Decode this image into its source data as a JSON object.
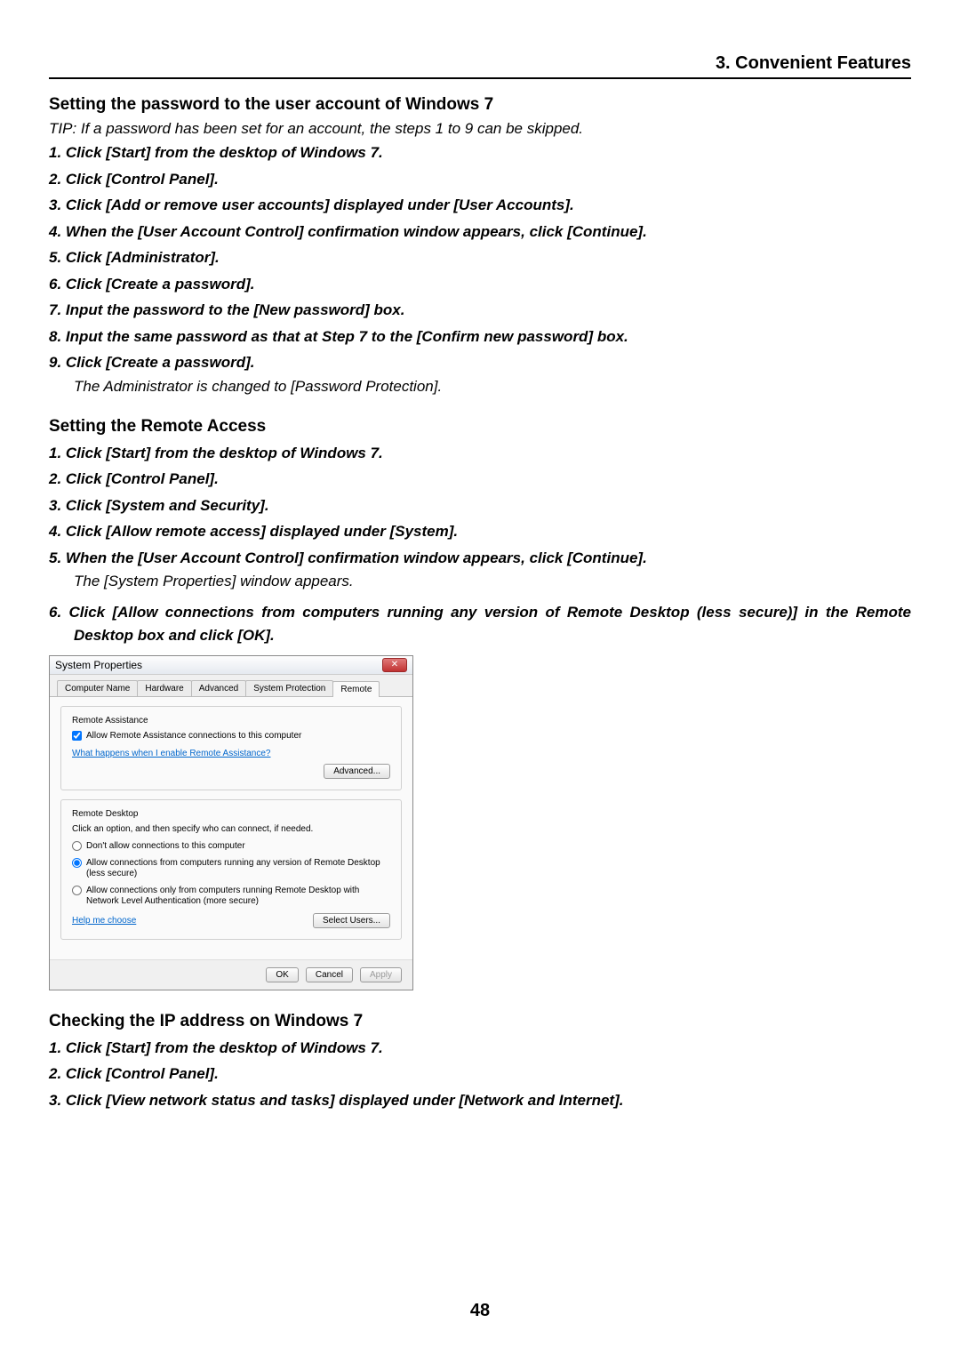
{
  "chapter_header": "3. Convenient Features",
  "section1": {
    "title": "Setting the password to the user account of Windows 7",
    "tip": "TIP: If a password has been set for an account, the steps 1 to 9 can be skipped.",
    "steps": [
      "1.  Click [Start] from the desktop of Windows 7.",
      "2.  Click [Control Panel].",
      "3.  Click [Add or remove user accounts] displayed under [User Accounts].",
      "4.  When the [User Account Control] confirmation window appears, click [Continue].",
      "5.  Click [Administrator].",
      "6.  Click [Create a password].",
      "7.  Input the password to the [New password] box.",
      "8.  Input the same password as that at Step 7 to the [Confirm new password] box.",
      "9.  Click [Create a password]."
    ],
    "result": "The Administrator is changed to [Password Protection]."
  },
  "section2": {
    "title": "Setting the Remote Access",
    "steps_pre": [
      "1.  Click [Start] from the desktop of Windows 7.",
      "2.  Click [Control Panel].",
      "3.  Click [System and Security].",
      "4.  Click [Allow remote access] displayed under [System].",
      "5.  When the [User Account Control] confirmation window appears, click [Continue]."
    ],
    "result5": "The [System Properties] window appears.",
    "step6": "6.  Click [Allow connections from computers running any version of Remote Desktop (less secure)] in the Remote Desktop box and click [OK]."
  },
  "dialog": {
    "title": "System Properties",
    "tabs": [
      "Computer Name",
      "Hardware",
      "Advanced",
      "System Protection",
      "Remote"
    ],
    "ra": {
      "group_title": "Remote Assistance",
      "checkbox_label": "Allow Remote Assistance connections to this computer",
      "link": "What happens when I enable Remote Assistance?",
      "advanced_btn": "Advanced..."
    },
    "rd": {
      "group_title": "Remote Desktop",
      "desc": "Click an option, and then specify who can connect, if needed.",
      "opt1": "Don't allow connections to this computer",
      "opt2": "Allow connections from computers running any version of Remote Desktop (less secure)",
      "opt3": "Allow connections only from computers running Remote Desktop with Network Level Authentication (more secure)",
      "help_link": "Help me choose",
      "select_users_btn": "Select Users..."
    },
    "buttons": {
      "ok": "OK",
      "cancel": "Cancel",
      "apply": "Apply"
    }
  },
  "section3": {
    "title": "Checking the IP address on Windows 7",
    "steps": [
      "1.  Click [Start] from the desktop of Windows 7.",
      "2.  Click [Control Panel].",
      "3.  Click [View network status and tasks] displayed under [Network and Internet]."
    ]
  },
  "page_number": "48"
}
